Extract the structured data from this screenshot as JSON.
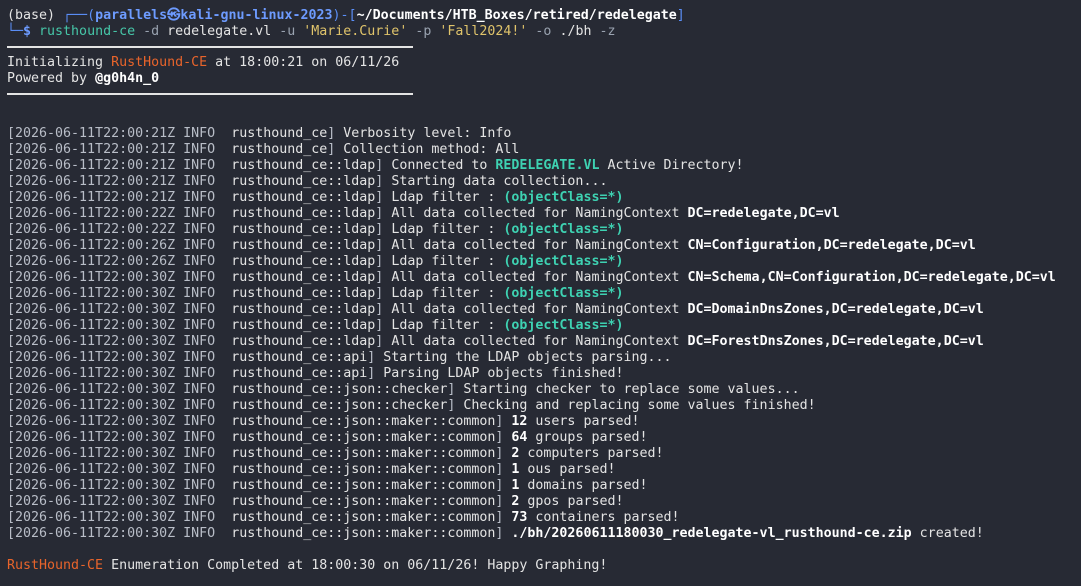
{
  "prompt": {
    "env": "(base) ",
    "corner_top": "┌──(",
    "user_host": "parallels㉿kali-gnu-linux-2023",
    "mid": ")-[",
    "path": "~/Documents/HTB_Boxes/retired/redelegate",
    "close": "]",
    "corner_bottom": "└─",
    "dollar": "$ ",
    "command": "rusthound-ce",
    "args": [
      {
        "t": " -d ",
        "c": "flag"
      },
      {
        "t": "redelegate.vl",
        "c": "plain"
      },
      {
        "t": " -u ",
        "c": "flag"
      },
      {
        "t": "'Marie.Curie'",
        "c": "str"
      },
      {
        "t": " -p ",
        "c": "flag"
      },
      {
        "t": "'Fall2024!'",
        "c": "str"
      },
      {
        "t": " -o ",
        "c": "flag"
      },
      {
        "t": "./bh",
        "c": "plain"
      },
      {
        "t": " -z",
        "c": "flag"
      }
    ]
  },
  "banner": {
    "init_prefix": "Initializing ",
    "tool_name": "RustHound-CE",
    "init_suffix": " at 18:00:21 on 06/11/26",
    "powered_prefix": "Powered by ",
    "author": "@g0h4n_0"
  },
  "logs": [
    {
      "ts": "[2026-06-11T22:00:21Z",
      "level": "INFO",
      "module": "rusthound_ce",
      "parts": [
        {
          "t": "Verbosity level: Info"
        }
      ]
    },
    {
      "ts": "[2026-06-11T22:00:21Z",
      "level": "INFO",
      "module": "rusthound_ce",
      "parts": [
        {
          "t": "Collection method: All"
        }
      ]
    },
    {
      "ts": "[2026-06-11T22:00:21Z",
      "level": "INFO",
      "module": "rusthound_ce::ldap",
      "parts": [
        {
          "t": "Connected to "
        },
        {
          "t": "REDELEGATE.VL",
          "s": "cyanb"
        },
        {
          "t": " Active Directory!"
        }
      ]
    },
    {
      "ts": "[2026-06-11T22:00:21Z",
      "level": "INFO",
      "module": "rusthound_ce::ldap",
      "parts": [
        {
          "t": "Starting data collection..."
        }
      ]
    },
    {
      "ts": "[2026-06-11T22:00:21Z",
      "level": "INFO",
      "module": "rusthound_ce::ldap",
      "parts": [
        {
          "t": "Ldap filter : "
        },
        {
          "t": "(objectClass=*)",
          "s": "cyanb"
        }
      ]
    },
    {
      "ts": "[2026-06-11T22:00:22Z",
      "level": "INFO",
      "module": "rusthound_ce::ldap",
      "parts": [
        {
          "t": "All data collected for NamingContext "
        },
        {
          "t": "DC=redelegate,DC=vl",
          "s": "bold"
        }
      ]
    },
    {
      "ts": "[2026-06-11T22:00:22Z",
      "level": "INFO",
      "module": "rusthound_ce::ldap",
      "parts": [
        {
          "t": "Ldap filter : "
        },
        {
          "t": "(objectClass=*)",
          "s": "cyanb"
        }
      ]
    },
    {
      "ts": "[2026-06-11T22:00:26Z",
      "level": "INFO",
      "module": "rusthound_ce::ldap",
      "parts": [
        {
          "t": "All data collected for NamingContext "
        },
        {
          "t": "CN=Configuration,DC=redelegate,DC=vl",
          "s": "bold"
        }
      ]
    },
    {
      "ts": "[2026-06-11T22:00:26Z",
      "level": "INFO",
      "module": "rusthound_ce::ldap",
      "parts": [
        {
          "t": "Ldap filter : "
        },
        {
          "t": "(objectClass=*)",
          "s": "cyanb"
        }
      ]
    },
    {
      "ts": "[2026-06-11T22:00:30Z",
      "level": "INFO",
      "module": "rusthound_ce::ldap",
      "parts": [
        {
          "t": "All data collected for NamingContext "
        },
        {
          "t": "CN=Schema,CN=Configuration,DC=redelegate,DC=vl",
          "s": "bold"
        }
      ]
    },
    {
      "ts": "[2026-06-11T22:00:30Z",
      "level": "INFO",
      "module": "rusthound_ce::ldap",
      "parts": [
        {
          "t": "Ldap filter : "
        },
        {
          "t": "(objectClass=*)",
          "s": "cyanb"
        }
      ]
    },
    {
      "ts": "[2026-06-11T22:00:30Z",
      "level": "INFO",
      "module": "rusthound_ce::ldap",
      "parts": [
        {
          "t": "All data collected for NamingContext "
        },
        {
          "t": "DC=DomainDnsZones,DC=redelegate,DC=vl",
          "s": "bold"
        }
      ]
    },
    {
      "ts": "[2026-06-11T22:00:30Z",
      "level": "INFO",
      "module": "rusthound_ce::ldap",
      "parts": [
        {
          "t": "Ldap filter : "
        },
        {
          "t": "(objectClass=*)",
          "s": "cyanb"
        }
      ]
    },
    {
      "ts": "[2026-06-11T22:00:30Z",
      "level": "INFO",
      "module": "rusthound_ce::ldap",
      "parts": [
        {
          "t": "All data collected for NamingContext "
        },
        {
          "t": "DC=ForestDnsZones,DC=redelegate,DC=vl",
          "s": "bold"
        }
      ]
    },
    {
      "ts": "[2026-06-11T22:00:30Z",
      "level": "INFO",
      "module": "rusthound_ce::api",
      "parts": [
        {
          "t": "Starting the LDAP objects parsing..."
        }
      ]
    },
    {
      "ts": "[2026-06-11T22:00:30Z",
      "level": "INFO",
      "module": "rusthound_ce::api",
      "parts": [
        {
          "t": "Parsing LDAP objects finished!"
        }
      ]
    },
    {
      "ts": "[2026-06-11T22:00:30Z",
      "level": "INFO",
      "module": "rusthound_ce::json::checker",
      "parts": [
        {
          "t": "Starting checker to replace some values..."
        }
      ]
    },
    {
      "ts": "[2026-06-11T22:00:30Z",
      "level": "INFO",
      "module": "rusthound_ce::json::checker",
      "parts": [
        {
          "t": "Checking and replacing some values finished!"
        }
      ]
    },
    {
      "ts": "[2026-06-11T22:00:30Z",
      "level": "INFO",
      "module": "rusthound_ce::json::maker::common",
      "parts": [
        {
          "t": "12",
          "s": "bold"
        },
        {
          "t": " users parsed!"
        }
      ]
    },
    {
      "ts": "[2026-06-11T22:00:30Z",
      "level": "INFO",
      "module": "rusthound_ce::json::maker::common",
      "parts": [
        {
          "t": "64",
          "s": "bold"
        },
        {
          "t": " groups parsed!"
        }
      ]
    },
    {
      "ts": "[2026-06-11T22:00:30Z",
      "level": "INFO",
      "module": "rusthound_ce::json::maker::common",
      "parts": [
        {
          "t": "2",
          "s": "bold"
        },
        {
          "t": " computers parsed!"
        }
      ]
    },
    {
      "ts": "[2026-06-11T22:00:30Z",
      "level": "INFO",
      "module": "rusthound_ce::json::maker::common",
      "parts": [
        {
          "t": "1",
          "s": "bold"
        },
        {
          "t": " ous parsed!"
        }
      ]
    },
    {
      "ts": "[2026-06-11T22:00:30Z",
      "level": "INFO",
      "module": "rusthound_ce::json::maker::common",
      "parts": [
        {
          "t": "1",
          "s": "bold"
        },
        {
          "t": " domains parsed!"
        }
      ]
    },
    {
      "ts": "[2026-06-11T22:00:30Z",
      "level": "INFO",
      "module": "rusthound_ce::json::maker::common",
      "parts": [
        {
          "t": "2",
          "s": "bold"
        },
        {
          "t": " gpos parsed!"
        }
      ]
    },
    {
      "ts": "[2026-06-11T22:00:30Z",
      "level": "INFO",
      "module": "rusthound_ce::json::maker::common",
      "parts": [
        {
          "t": "73",
          "s": "bold"
        },
        {
          "t": " containers parsed!"
        }
      ]
    },
    {
      "ts": "[2026-06-11T22:00:30Z",
      "level": "INFO",
      "module": "rusthound_ce::json::maker::common",
      "parts": [
        {
          "t": "./bh/20260611180030_redelegate-vl_rusthound-ce.zip",
          "s": "bold"
        },
        {
          "t": " created!"
        }
      ]
    }
  ],
  "footer": {
    "tool_name": "RustHound-CE",
    "text": " Enumeration Completed at 18:00:30 on 06/11/26! Happy Graphing!"
  },
  "colors": {
    "background": "#272a34",
    "prompt_blue": "#5a8ef7",
    "command_teal": "#46c6a8",
    "string_yellow": "#e0c46b",
    "brand_orange": "#e8642b",
    "highlight_cyan": "#3ed2b2"
  }
}
